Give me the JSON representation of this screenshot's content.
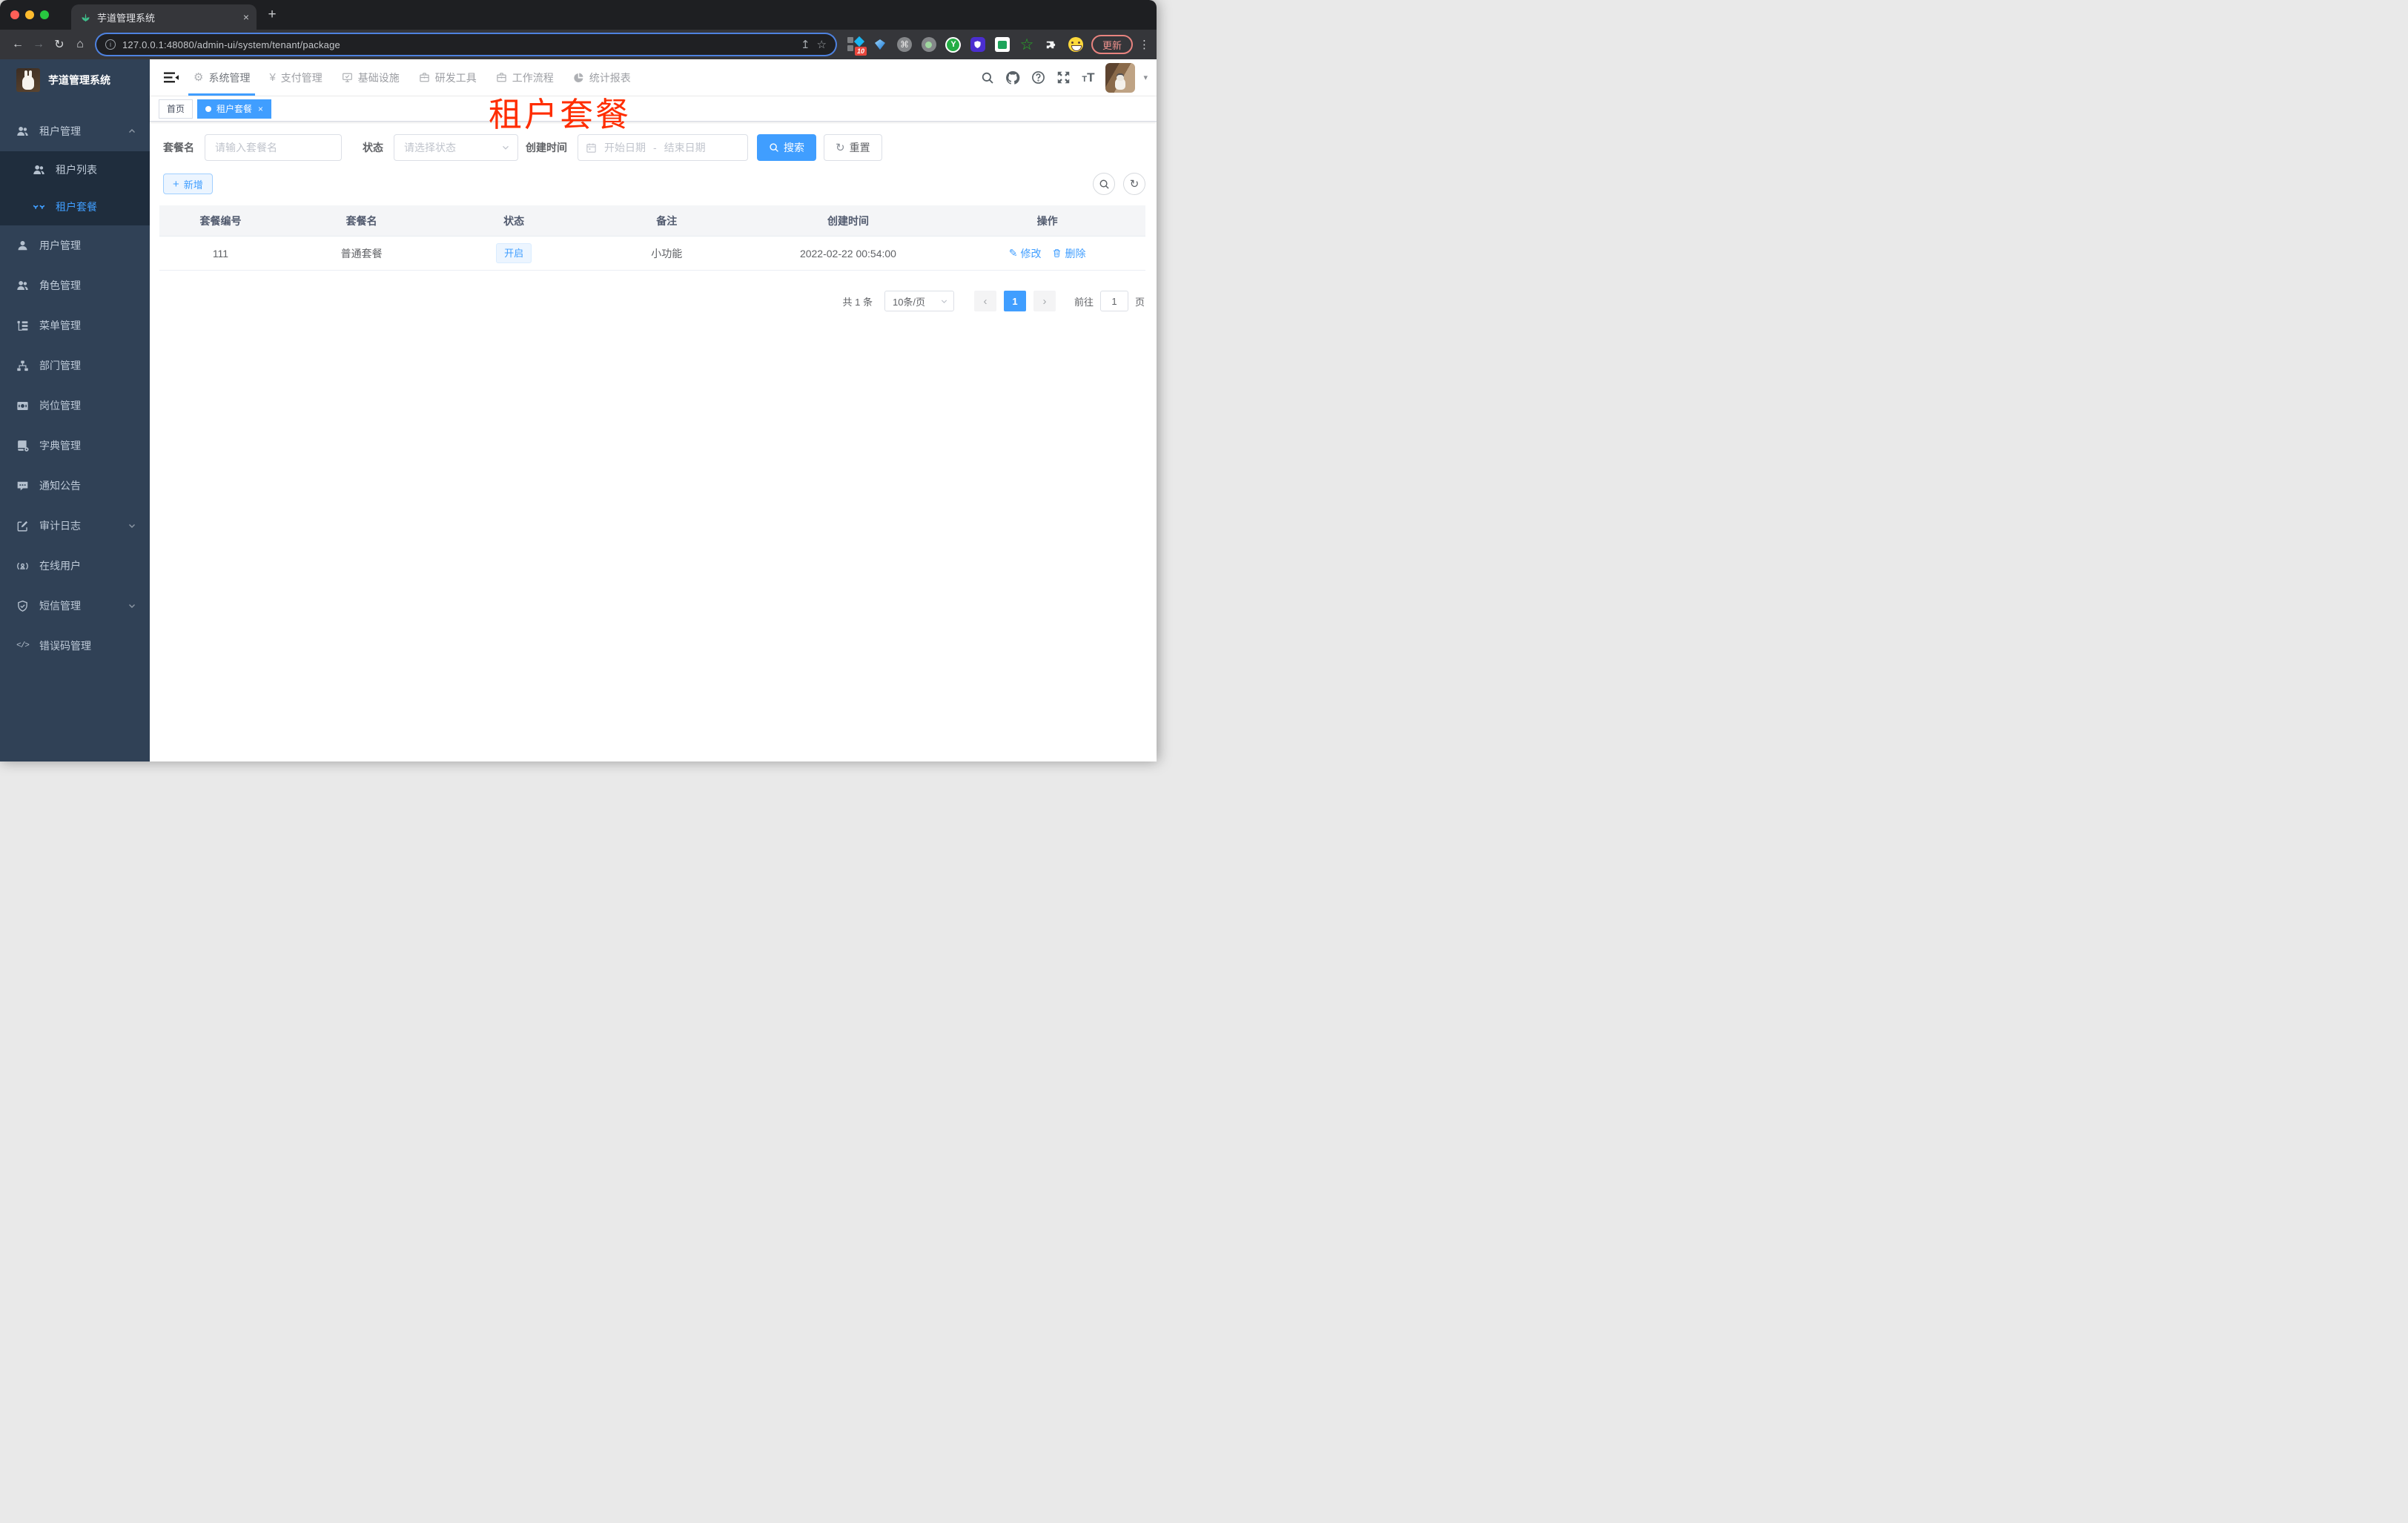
{
  "browser": {
    "tab_title": "芋道管理系统",
    "url": "127.0.0.1:48080/admin-ui/system/tenant/package",
    "update_label": "更新",
    "ext_badge": "10"
  },
  "glyphs": {
    "back": "←",
    "forward": "→",
    "reload": "↻",
    "home": "⌂",
    "info": "i",
    "share": "↥",
    "star": "☆",
    "plus": "+",
    "close": "×",
    "dots": "⋮",
    "command": "⌘",
    "yen": "¥",
    "gear": "⚙",
    "caret": "▾",
    "refresh": "↻",
    "edit": "✎",
    "prev": "‹",
    "next": "›",
    "t": "T",
    "y": "Y",
    "code": "</>"
  },
  "nav": {
    "items": [
      {
        "label": "系统管理"
      },
      {
        "label": "支付管理"
      },
      {
        "label": "基础设施"
      },
      {
        "label": "研发工具"
      },
      {
        "label": "工作流程"
      },
      {
        "label": "统计报表"
      }
    ]
  },
  "sidebar": {
    "title": "芋道管理系统",
    "items": [
      {
        "label": "租户管理"
      },
      {
        "label": "租户列表"
      },
      {
        "label": "租户套餐"
      },
      {
        "label": "用户管理"
      },
      {
        "label": "角色管理"
      },
      {
        "label": "菜单管理"
      },
      {
        "label": "部门管理"
      },
      {
        "label": "岗位管理"
      },
      {
        "label": "字典管理"
      },
      {
        "label": "通知公告"
      },
      {
        "label": "审计日志"
      },
      {
        "label": "在线用户"
      },
      {
        "label": "短信管理"
      },
      {
        "label": "错误码管理"
      }
    ]
  },
  "tags": {
    "home": "首页",
    "active": "租户套餐"
  },
  "overlay": {
    "text": "租户套餐",
    "color": "#ff2d00"
  },
  "filters": {
    "name_label": "套餐名",
    "name_placeholder": "请输入套餐名",
    "status_label": "状态",
    "status_placeholder": "请选择状态",
    "date_label": "创建时间",
    "date_start": "开始日期",
    "date_sep": "-",
    "date_end": "结束日期",
    "search": "搜索",
    "reset": "重置"
  },
  "toolbar": {
    "add": "新增"
  },
  "table": {
    "headers": [
      "套餐编号",
      "套餐名",
      "状态",
      "备注",
      "创建时间",
      "操作"
    ],
    "rows": [
      {
        "id": "111",
        "name": "普通套餐",
        "status": "开启",
        "remark": "小功能",
        "created": "2022-02-22 00:54:00",
        "edit": "修改",
        "delete": "删除"
      }
    ]
  },
  "pagination": {
    "total": "共 1 条",
    "page_size": "10条/页",
    "current": "1",
    "goto": "前往",
    "goto_value": "1",
    "unit": "页"
  },
  "colors": {
    "accent": "#409eff",
    "sidebar_bg": "#304156",
    "submenu_bg": "#1f2d3d",
    "overlay_red": "#ff2d00"
  }
}
